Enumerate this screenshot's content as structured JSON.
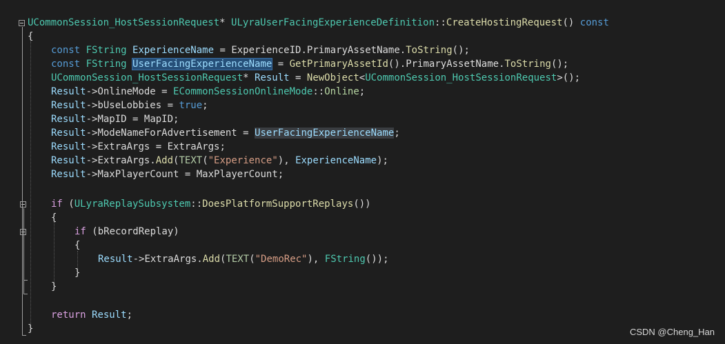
{
  "lines": {
    "l1": {
      "ret_type": "UCommonSession_HostSessionRequest",
      "ptr": "* ",
      "class": "ULyraUserFacingExperienceDefinition",
      "scope": "::",
      "func": "CreateHostingRequest",
      "parens": "() ",
      "kw": "const"
    },
    "l2": {
      "text": "{"
    },
    "l3": {
      "kw": "const ",
      "type": "FString ",
      "var": "ExperienceName",
      "eq": " = ",
      "obj": "ExperienceID",
      "dot": ".",
      "member": "PrimaryAssetName",
      "dot2": ".",
      "func": "ToString",
      "end": "();"
    },
    "l4": {
      "kw": "const ",
      "type": "FString ",
      "var": "UserFacingExperienceName",
      "eq": " = ",
      "func": "GetPrimaryAssetId",
      "mid": "().",
      "member": "PrimaryAssetName",
      "dot": ".",
      "func2": "ToString",
      "end": "();"
    },
    "l5": {
      "type": "UCommonSession_HostSessionRequest",
      "ptr": "* ",
      "var": "Result",
      "eq": " = ",
      "func": "NewObject",
      "lt": "<",
      "targ": "UCommonSession_HostSessionRequest",
      "end": ">();"
    },
    "l6": {
      "var": "Result",
      "arrow": "->",
      "member": "OnlineMode",
      "eq": " = ",
      "enum": "ECommonSessionOnlineMode",
      "scope": "::",
      "val": "Online",
      "end": ";"
    },
    "l7": {
      "var": "Result",
      "arrow": "->",
      "member": "bUseLobbies",
      "eq": " = ",
      "kw": "true",
      "end": ";"
    },
    "l8": {
      "var": "Result",
      "arrow": "->",
      "member": "MapID",
      "eq": " = ",
      "rhs": "MapID",
      "end": ";"
    },
    "l9": {
      "var": "Result",
      "arrow": "->",
      "member": "ModeNameForAdvertisement",
      "eq": " = ",
      "rhs": "UserFacingExperienceName",
      "end": ";"
    },
    "l10": {
      "var": "Result",
      "arrow": "->",
      "member": "ExtraArgs",
      "eq": " = ",
      "rhs": "ExtraArgs",
      "end": ";"
    },
    "l11": {
      "var": "Result",
      "arrow": "->",
      "member": "ExtraArgs",
      "dot": ".",
      "func": "Add",
      "open": "(",
      "macro": "TEXT",
      "open2": "(",
      "str": "\"Experience\"",
      "close": "), ",
      "arg": "ExperienceName",
      "end": ");"
    },
    "l12": {
      "var": "Result",
      "arrow": "->",
      "member": "MaxPlayerCount",
      "eq": " = ",
      "rhs": "MaxPlayerCount",
      "end": ";"
    },
    "l14": {
      "kw": "if",
      "open": " (",
      "type": "ULyraReplaySubsystem",
      "scope": "::",
      "func": "DoesPlatformSupportReplays",
      "end": "())"
    },
    "l15": {
      "text": "{"
    },
    "l16": {
      "kw": "if",
      "open": " (",
      "var": "bRecordReplay",
      "end": ")"
    },
    "l17": {
      "text": "{"
    },
    "l18": {
      "var": "Result",
      "arrow": "->",
      "member": "ExtraArgs",
      "dot": ".",
      "func": "Add",
      "open": "(",
      "macro": "TEXT",
      "open2": "(",
      "str": "\"DemoRec\"",
      "close": "), ",
      "type": "FString",
      "end": "());"
    },
    "l19": {
      "text": "}"
    },
    "l20": {
      "text": "}"
    },
    "l22": {
      "kw": "return",
      "sp": " ",
      "var": "Result",
      "end": ";"
    },
    "l23": {
      "text": "}"
    }
  },
  "watermark": "CSDN @Cheng_Han",
  "colors": {
    "background": "#1e1e1e",
    "type": "#4ec9b0",
    "variable": "#9cdcfe",
    "keyword": "#569cd6",
    "control_keyword": "#d8a0df",
    "function": "#dcdcaa",
    "string": "#d69d85",
    "selection": "#264f78"
  }
}
